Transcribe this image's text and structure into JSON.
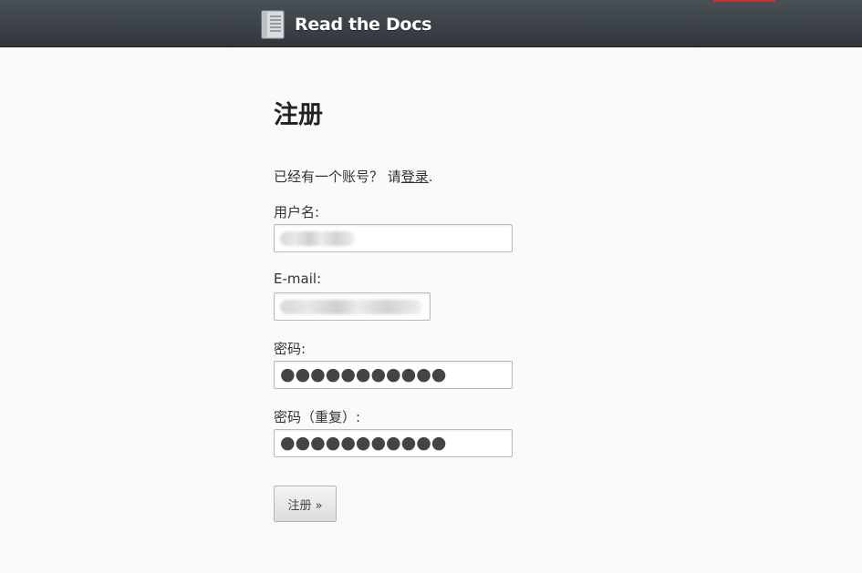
{
  "header": {
    "brand_name": "Read the Docs",
    "logo_icon": "book-icon",
    "accent_color": "#c9302c",
    "bar_color": "#3a4045"
  },
  "form": {
    "title": "注册",
    "login_prompt_prefix": "已经有一个账号？ 请",
    "login_link_text": "登录",
    "login_prompt_suffix": ".",
    "fields": {
      "username": {
        "label": "用户名:",
        "value_state": "blurred"
      },
      "email": {
        "label": "E-mail:",
        "value_state": "blurred"
      },
      "password1": {
        "label": "密码:",
        "masked_value": "●●●●●●●●●●●"
      },
      "password2": {
        "label": "密码（重复）:",
        "masked_value": "●●●●●●●●●●●"
      }
    },
    "submit_label": "注册 »"
  }
}
